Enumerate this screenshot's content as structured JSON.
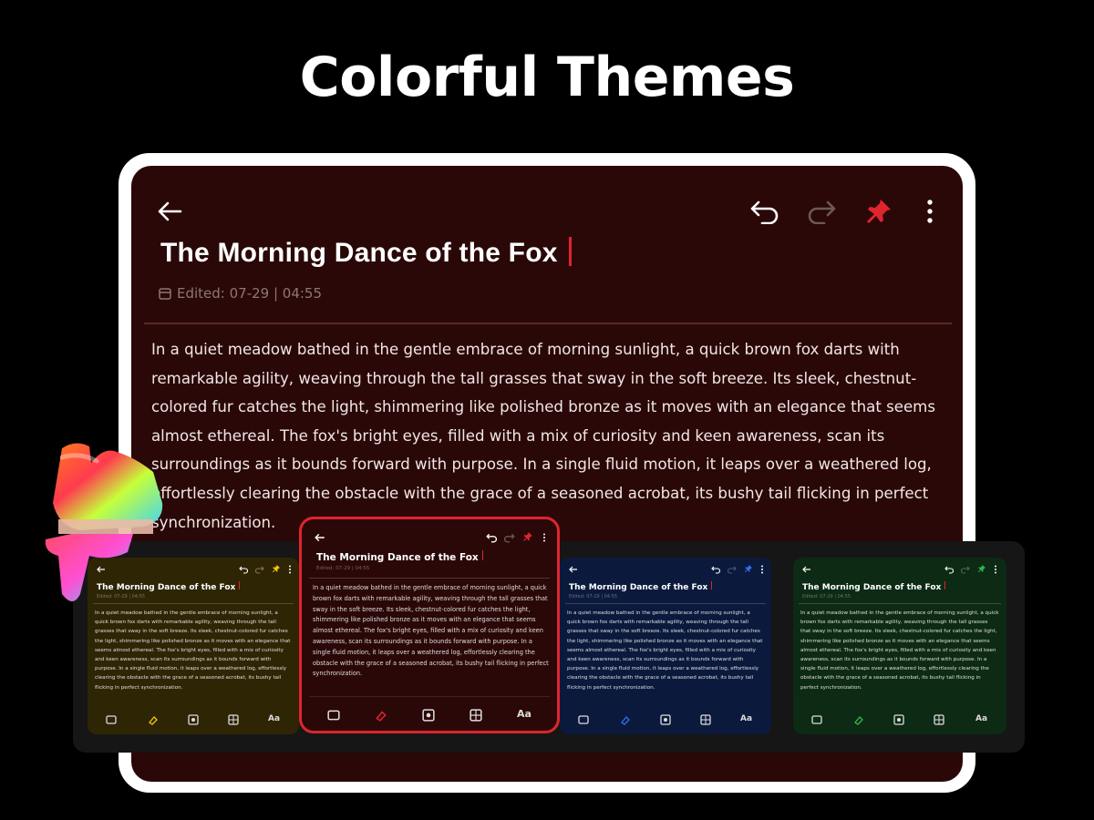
{
  "headline": "Colorful Themes",
  "note": {
    "title": "The Morning Dance of the Fox",
    "edited": "Edited: 07-29 | 04:55",
    "body": "In a quiet meadow bathed in the gentle embrace of morning sunlight, a quick brown fox darts with remarkable agility, weaving through the tall grasses that sway in the soft breeze. Its sleek, chestnut-colored fur catches the light, shimmering like polished bronze as it moves with an elegance that seems almost ethereal. The fox's bright eyes, filled with a mix of curiosity and keen awareness, scan its surroundings as it bounds forward with purpose. In a single fluid motion, it leaps over a weathered log, effortlessly clearing the obstacle with the grace of a seasoned acrobat, its bushy tail flicking in perfect synchronization."
  },
  "toolbar_icons": [
    "back-arrow-icon",
    "undo-icon",
    "redo-icon",
    "pin-icon",
    "more-vert-icon"
  ],
  "theme_cards": [
    {
      "name": "yellow",
      "bg": "#2e2505",
      "accent": "#f3c615"
    },
    {
      "name": "red",
      "bg": "#2a0808",
      "accent": "#e0242e",
      "selected": true
    },
    {
      "name": "blue",
      "bg": "#0b1a3c",
      "accent": "#2f6ff0"
    },
    {
      "name": "green",
      "bg": "#0d2a15",
      "accent": "#2fb84e"
    }
  ],
  "colors": {
    "screen_bg": "#2a0808",
    "accent": "#e0242e",
    "selection_ring": "#e0242e"
  },
  "bottom_bar_icons": [
    "gallery-icon",
    "theme-brush-icon",
    "image-icon",
    "grid-icon",
    "font-size-icon"
  ],
  "font_label": "Aa"
}
